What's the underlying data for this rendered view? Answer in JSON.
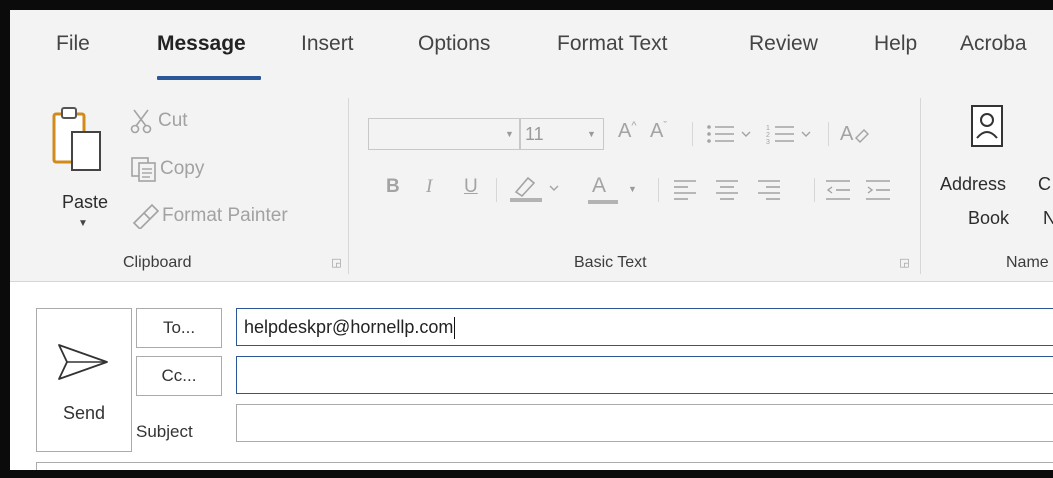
{
  "tabs": [
    {
      "label": "File"
    },
    {
      "label": "Message"
    },
    {
      "label": "Insert"
    },
    {
      "label": "Options"
    },
    {
      "label": "Format Text"
    },
    {
      "label": "Review"
    },
    {
      "label": "Help"
    },
    {
      "label": "Acroba"
    }
  ],
  "active_tab": "Message",
  "clipboard": {
    "paste_label": "Paste",
    "cut_label": "Cut",
    "copy_label": "Copy",
    "format_painter_label": "Format Painter",
    "group_label": "Clipboard"
  },
  "basic_text": {
    "font_name": "",
    "font_size": "11",
    "group_label": "Basic Text",
    "bold": "B",
    "italic": "I",
    "underline": "U",
    "font_color_letter": "A",
    "grow_font": "A",
    "shrink_font": "A"
  },
  "names": {
    "address_book_line1": "Address",
    "address_book_line2": "Book",
    "group_label_partial": "Name"
  },
  "compose": {
    "send_label": "Send",
    "to_label": "To...",
    "cc_label": "Cc...",
    "subject_label": "Subject",
    "to_value": "helpdeskpr@hornellp.com",
    "cc_value": "",
    "subject_value": ""
  },
  "colors": {
    "accent": "#2b579a",
    "ribbon_bg": "#f3f3f3",
    "disabled_icon": "#a3a3a3"
  }
}
